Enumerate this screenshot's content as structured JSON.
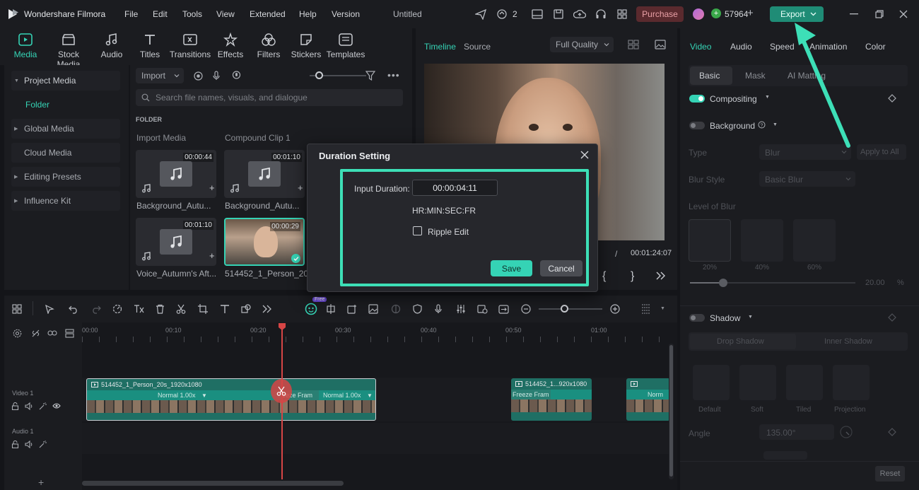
{
  "app": {
    "name": "Wondershare Filmora",
    "menu": [
      "File",
      "Edit",
      "Tools",
      "View",
      "Extended",
      "Help",
      "Version"
    ],
    "project_title": "Untitled",
    "notifications_count": "2",
    "purchase_label": "Purchase",
    "credits": "57964",
    "export_label": "Export"
  },
  "tools": [
    {
      "label": "Media",
      "icon": "media-icon"
    },
    {
      "label": "Stock Media",
      "icon": "stock-media-icon"
    },
    {
      "label": "Audio",
      "icon": "audio-icon"
    },
    {
      "label": "Titles",
      "icon": "titles-icon"
    },
    {
      "label": "Transitions",
      "icon": "transitions-icon"
    },
    {
      "label": "Effects",
      "icon": "effects-icon"
    },
    {
      "label": "Filters",
      "icon": "filters-icon"
    },
    {
      "label": "Stickers",
      "icon": "stickers-icon"
    },
    {
      "label": "Templates",
      "icon": "templates-icon"
    }
  ],
  "sidebar": {
    "items": [
      "Project Media",
      "Folder",
      "Global Media",
      "Cloud Media",
      "Editing Presets",
      "Influence Kit"
    ]
  },
  "media": {
    "import_label": "Import",
    "search_placeholder": "Search file names, visuals, and dialogue",
    "folder_heading": "FOLDER",
    "import_media_label": "Import Media",
    "compound_clip_label": "Compound Clip 1",
    "items": [
      {
        "name": "Background_Autu...",
        "duration": "00:00:44"
      },
      {
        "name": "Background_Autu...",
        "duration": "00:01:10"
      },
      {
        "name": "Voice_Autumn's Aft...",
        "duration": "00:01:10"
      },
      {
        "name": "514452_1_Person_20...",
        "duration": "00:00:29"
      }
    ]
  },
  "preview": {
    "tabs": [
      "Timeline",
      "Source"
    ],
    "quality": "Full Quality",
    "separator": "/",
    "total_time": "00:01:24:07"
  },
  "right_panel": {
    "tabs": [
      "Video",
      "Audio",
      "Speed",
      "Animation",
      "Color"
    ],
    "subtabs": [
      "Basic",
      "Mask",
      "AI Matting"
    ],
    "compositing_label": "Compositing",
    "background_label": "Background",
    "type_label": "Type",
    "type_value": "Blur",
    "apply_all_label": "Apply to All",
    "blur_style_label": "Blur Style",
    "blur_style_value": "Basic Blur",
    "level_of_blur_label": "Level of Blur",
    "blur_levels": [
      "20%",
      "40%",
      "60%"
    ],
    "blur_value": "20.00",
    "blur_unit": "%",
    "blur_fraction": 0.2,
    "shadow_label": "Shadow",
    "shadow_tabs": [
      "Drop Shadow",
      "Inner Shadow"
    ],
    "shadow_types": [
      "Default",
      "Soft",
      "Tiled",
      "Projection"
    ],
    "angle_label": "Angle",
    "angle_value": "135.00°",
    "reset_label": "Reset"
  },
  "timeline": {
    "ticks": [
      "00:00",
      "00:10",
      "00:20",
      "00:30",
      "00:40",
      "00:50",
      "01:00"
    ],
    "free_badge": "Free",
    "tracks": [
      {
        "label": "Video 1"
      },
      {
        "label": "Audio 1"
      }
    ],
    "clips": {
      "main_name": "514452_1_Person_20s_1920x1080",
      "main_speed": "Normal 1.00x",
      "freeze_label": "eeze Fram",
      "second_speed": "Normal 1.00x",
      "right_name": "514452_1...920x1080",
      "right_freeze": "Freeze Fram",
      "far_right_speed": "Norm"
    }
  },
  "dialog": {
    "title": "Duration Setting",
    "input_label": "Input Duration:",
    "input_value": "00:00:04:11",
    "format_hint": "HR:MIN:SEC:FR",
    "ripple_label": "Ripple Edit",
    "save_label": "Save",
    "cancel_label": "Cancel"
  },
  "colors": {
    "accent": "#35d3b5",
    "highlight": "#3ddfb7",
    "export_bg": "#1f8c76",
    "purchase_bg": "#5a2a2e",
    "playhead": "#d64545"
  }
}
